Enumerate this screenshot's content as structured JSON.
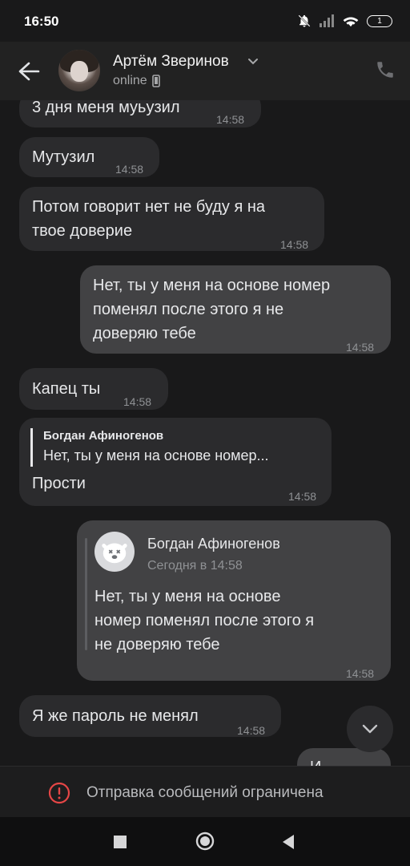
{
  "status_bar": {
    "time": "16:50",
    "battery": "1"
  },
  "header": {
    "contact_name": "Артём Зверинов",
    "presence": "online"
  },
  "messages": [
    {
      "text": "3 дня меня муьузил",
      "time": "14:58",
      "direction": "in"
    },
    {
      "text": "Мутузил",
      "time": "14:58",
      "direction": "in"
    },
    {
      "text": "Потом говорит нет не буду я на\nтвое доверие",
      "time": "14:58",
      "direction": "in"
    },
    {
      "text": "Нет, ты у меня на основе номер\nпоменял после этого я не\nдоверяю тебе",
      "time": "14:58",
      "direction": "out"
    },
    {
      "text": "Капец ты",
      "time": "14:58",
      "direction": "in"
    },
    {
      "direction": "in",
      "reply_author": "Богдан Афиногенов",
      "reply_text": "Нет, ты у меня на основе номер...",
      "text": "Прости",
      "time": "14:58"
    },
    {
      "direction": "out",
      "forward_author": "Богдан Афиногенов",
      "forward_date": "Сегодня в 14:58",
      "forward_text": "Нет, ты у меня на основе\nномер поменял после этого я\nне доверяю тебе",
      "time": "14:58"
    },
    {
      "text": "Я же пароль не менял",
      "time": "14:58",
      "direction": "in"
    },
    {
      "text": "И",
      "direction": "out"
    }
  ],
  "restriction_notice": "Отправка сообщений ограничена",
  "colors": {
    "accent": "#e64646",
    "bubble_in": "#2b2b2d",
    "bubble_out": "#424244"
  }
}
